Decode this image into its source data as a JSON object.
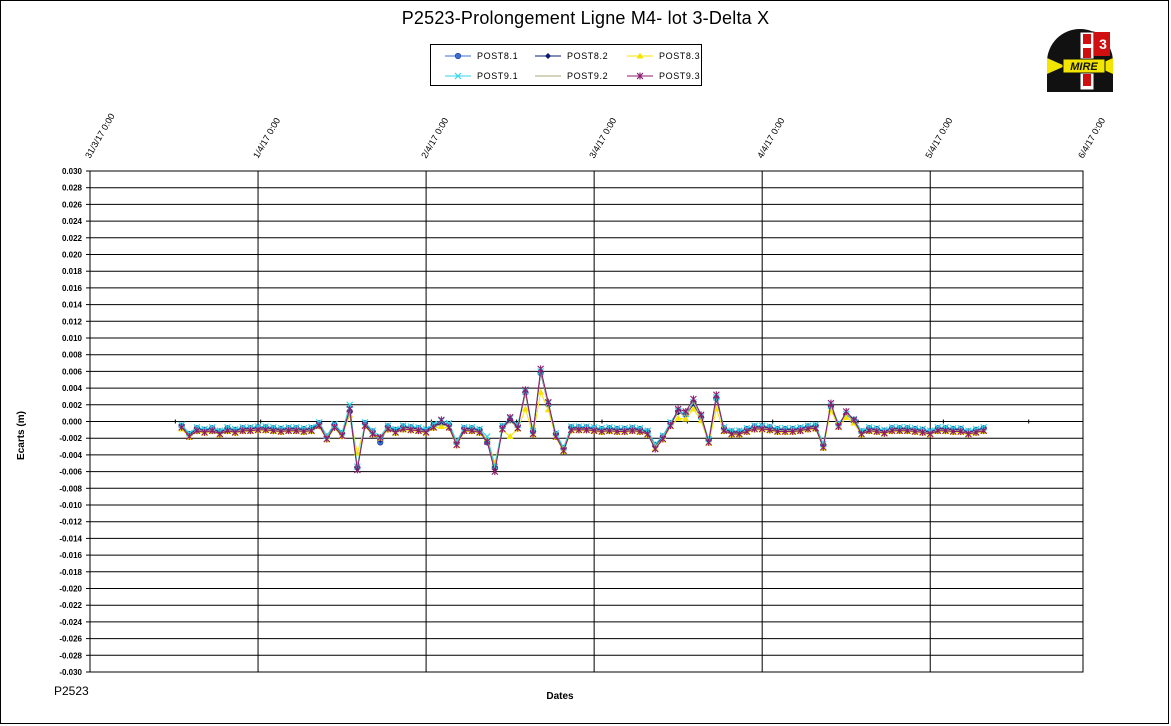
{
  "chart_data": {
    "type": "line",
    "title": "P2523-Prolongement  Ligne  M4- lot 3-Delta X",
    "footer": "P2523",
    "xlabel": "Dates",
    "ylabel": "Ecarts (m)",
    "ylim": [
      -0.03,
      0.03
    ],
    "ytick_step": 0.002,
    "yticks": [
      "0.030",
      "0.028",
      "0.026",
      "0.024",
      "0.022",
      "0.020",
      "0.018",
      "0.016",
      "0.014",
      "0.012",
      "0.010",
      "0.008",
      "0.006",
      "0.004",
      "0.002",
      "0.000",
      "-0.002",
      "-0.004",
      "-0.006",
      "-0.008",
      "-0.010",
      "-0.012",
      "-0.014",
      "-0.016",
      "-0.018",
      "-0.020",
      "-0.022",
      "-0.024",
      "-0.026",
      "-0.028",
      "-0.030"
    ],
    "xlim": [
      "2017-03-31",
      "2017-06-04"
    ],
    "xticks": [
      {
        "label": "31/3/17 0:00",
        "date": "2017-03-31"
      },
      {
        "label": "1/4/17 0:00",
        "date": "2017-04-11"
      },
      {
        "label": "2/4/17 0:00",
        "date": "2017-04-22"
      },
      {
        "label": "3/4/17 0:00",
        "date": "2017-05-03"
      },
      {
        "label": "4/4/17 0:00",
        "date": "2017-05-14"
      },
      {
        "label": "5/4/17 0:00",
        "date": "2017-05-25"
      },
      {
        "label": "6/4/17 0:00",
        "date": "2017-06-04"
      }
    ],
    "grid": true,
    "legend_position": "top-center",
    "x": [
      "2017-04-06",
      "2017-04-06T12",
      "2017-04-07",
      "2017-04-07T12",
      "2017-04-08",
      "2017-04-08T12",
      "2017-04-09",
      "2017-04-09T12",
      "2017-04-10",
      "2017-04-10T12",
      "2017-04-11",
      "2017-04-11T12",
      "2017-04-12",
      "2017-04-12T12",
      "2017-04-13",
      "2017-04-13T12",
      "2017-04-14",
      "2017-04-14T12",
      "2017-04-15",
      "2017-04-15T12",
      "2017-04-16",
      "2017-04-16T12",
      "2017-04-17",
      "2017-04-17T12",
      "2017-04-18",
      "2017-04-18T12",
      "2017-04-19",
      "2017-04-19T12",
      "2017-04-20",
      "2017-04-20T12",
      "2017-04-21",
      "2017-04-21T12",
      "2017-04-22",
      "2017-04-22T12",
      "2017-04-23",
      "2017-04-23T12",
      "2017-04-24",
      "2017-04-24T12",
      "2017-04-25",
      "2017-04-25T12",
      "2017-04-26",
      "2017-04-26T12",
      "2017-04-27",
      "2017-04-27T12",
      "2017-04-28",
      "2017-04-28T12",
      "2017-04-29",
      "2017-04-29T12",
      "2017-04-30",
      "2017-04-30T12",
      "2017-05-01",
      "2017-05-01T12",
      "2017-05-02",
      "2017-05-02T12",
      "2017-05-03",
      "2017-05-03T12",
      "2017-05-04",
      "2017-05-04T12",
      "2017-05-05",
      "2017-05-05T12",
      "2017-05-06",
      "2017-05-06T12",
      "2017-05-07",
      "2017-05-07T12",
      "2017-05-08",
      "2017-05-08T12",
      "2017-05-09",
      "2017-05-09T12",
      "2017-05-10",
      "2017-05-10T12",
      "2017-05-11",
      "2017-05-11T12",
      "2017-05-12",
      "2017-05-12T12",
      "2017-05-13",
      "2017-05-13T12",
      "2017-05-14",
      "2017-05-14T12",
      "2017-05-15",
      "2017-05-15T12",
      "2017-05-16",
      "2017-05-16T12",
      "2017-05-17",
      "2017-05-17T12",
      "2017-05-18",
      "2017-05-18T12",
      "2017-05-19",
      "2017-05-19T12",
      "2017-05-20",
      "2017-05-20T12",
      "2017-05-21",
      "2017-05-21T12",
      "2017-05-22",
      "2017-05-22T12",
      "2017-05-23",
      "2017-05-23T12",
      "2017-05-24",
      "2017-05-24T12",
      "2017-05-25",
      "2017-05-25T12",
      "2017-05-26",
      "2017-05-26T12",
      "2017-05-27",
      "2017-05-27T12",
      "2017-05-28",
      "2017-05-28T12",
      "2017-05-29",
      "2017-05-29T12",
      "2017-05-30",
      "2017-05-30T12"
    ],
    "series": [
      {
        "name": "POST8.1",
        "color": "#3a6fd8",
        "marker": "circle",
        "values": [
          -0.0005,
          -0.0015,
          -0.0008,
          -0.001,
          -0.0008,
          -0.0012,
          -0.0008,
          -0.001,
          -0.0008,
          -0.0008,
          -0.0007,
          -0.0007,
          -0.0008,
          -0.0009,
          -0.0008,
          -0.0008,
          -0.0009,
          -0.0008,
          -0.0002,
          -0.0018,
          -0.0004,
          -0.0014,
          0.0012,
          -0.0055,
          -0.0002,
          -0.0012,
          -0.0025,
          -0.0006,
          -0.001,
          -0.0006,
          -0.0007,
          -0.0008,
          -0.001,
          -0.0004,
          -0.0002,
          -0.0004,
          -0.0025,
          -0.0008,
          -0.0008,
          -0.001,
          -0.0025,
          -0.0055,
          -0.0006,
          0.0002,
          -0.0005,
          0.0035,
          -0.0012,
          0.0058,
          0.002,
          -0.0015,
          -0.0032,
          -0.0007,
          -0.0007,
          -0.0007,
          -0.0008,
          -0.0009,
          -0.0008,
          -0.0009,
          -0.0009,
          -0.0008,
          -0.0009,
          -0.0012,
          -0.0028,
          -0.0018,
          -0.0002,
          0.0012,
          0.0008,
          0.0022,
          0.0005,
          -0.0022,
          0.0028,
          -0.0008,
          -0.0012,
          -0.0012,
          -0.0009,
          -0.0006,
          -0.0006,
          -0.0007,
          -0.0009,
          -0.0009,
          -0.0009,
          -0.0008,
          -0.0006,
          -0.0005,
          -0.0028,
          0.0018,
          -0.0003,
          0.0008,
          0.0002,
          -0.0012,
          -0.0008,
          -0.0009,
          -0.0011,
          -0.0008,
          -0.0008,
          -0.0008,
          -0.0009,
          -0.001,
          -0.0012,
          -0.0008,
          -0.0008,
          -0.0009,
          -0.0009,
          -0.0012,
          -0.001,
          -0.0008
        ]
      },
      {
        "name": "POST8.2",
        "color": "#0d1b6e",
        "marker": "diamond",
        "values": [
          -0.0006,
          -0.0016,
          -0.0009,
          -0.0011,
          -0.0009,
          -0.0013,
          -0.0009,
          -0.0011,
          -0.0009,
          -0.0009,
          -0.0008,
          -0.0008,
          -0.0009,
          -0.001,
          -0.0009,
          -0.0009,
          -0.001,
          -0.0009,
          -0.0003,
          -0.0019,
          -0.0005,
          -0.0015,
          0.0011,
          -0.0056,
          -0.0003,
          -0.0013,
          -0.0022,
          -0.0007,
          -0.0011,
          -0.0007,
          -0.0008,
          -0.0009,
          -0.0011,
          -0.0005,
          -0.0003,
          -0.0005,
          -0.0026,
          -0.0009,
          -0.0009,
          -0.0011,
          -0.0022,
          -0.0056,
          -0.0007,
          0.0001,
          -0.0006,
          0.0034,
          -0.0013,
          0.0059,
          0.0021,
          -0.0016,
          -0.0033,
          -0.0008,
          -0.0008,
          -0.0008,
          -0.0009,
          -0.001,
          -0.0009,
          -0.001,
          -0.001,
          -0.0009,
          -0.001,
          -0.0013,
          -0.0029,
          -0.0019,
          -0.0003,
          0.0011,
          0.0007,
          0.0021,
          0.0004,
          -0.0023,
          0.0027,
          -0.0009,
          -0.0013,
          -0.0013,
          -0.001,
          -0.0007,
          -0.0007,
          -0.0008,
          -0.001,
          -0.001,
          -0.001,
          -0.0009,
          -0.0007,
          -0.0006,
          -0.0029,
          0.0017,
          -0.0004,
          0.0009,
          0.0001,
          -0.0013,
          -0.0009,
          -0.001,
          -0.0012,
          -0.0009,
          -0.0009,
          -0.0009,
          -0.001,
          -0.0011,
          -0.0013,
          -0.0009,
          -0.0009,
          -0.001,
          -0.001,
          -0.0013,
          -0.0011,
          -0.0009
        ]
      },
      {
        "name": "POST8.3",
        "color": "#f5e400",
        "marker": "triangle",
        "values": [
          -0.0009,
          -0.0019,
          -0.0012,
          -0.0014,
          -0.0012,
          -0.0016,
          -0.0012,
          -0.0014,
          -0.0012,
          -0.0012,
          -0.0011,
          -0.0011,
          -0.0012,
          -0.0013,
          -0.0012,
          -0.0012,
          -0.0013,
          -0.0012,
          -0.0006,
          -0.0022,
          -0.0008,
          -0.0018,
          0.0008,
          -0.0038,
          -0.0006,
          -0.0016,
          -0.002,
          -0.001,
          -0.0014,
          -0.001,
          -0.0011,
          -0.0012,
          -0.0014,
          -0.0008,
          -0.0006,
          -0.0008,
          -0.0029,
          -0.0012,
          -0.0012,
          -0.0014,
          -0.002,
          -0.005,
          -0.001,
          -0.0018,
          -0.0009,
          0.0015,
          -0.0016,
          0.0035,
          0.0014,
          -0.0019,
          -0.0036,
          -0.0011,
          -0.0011,
          -0.0011,
          -0.0012,
          -0.0013,
          -0.0012,
          -0.0013,
          -0.0013,
          -0.0012,
          -0.0013,
          -0.0016,
          -0.0032,
          -0.0022,
          -0.0006,
          0.0004,
          0.0003,
          0.0015,
          0.0001,
          -0.0026,
          0.0015,
          -0.0012,
          -0.0016,
          -0.0016,
          -0.0013,
          -0.001,
          -0.001,
          -0.0011,
          -0.0013,
          -0.0013,
          -0.0013,
          -0.0012,
          -0.001,
          -0.0009,
          -0.0032,
          0.0014,
          -0.0007,
          0.0005,
          -0.0002,
          -0.0016,
          -0.0012,
          -0.0013,
          -0.0015,
          -0.0012,
          -0.0012,
          -0.0012,
          -0.0013,
          -0.0014,
          -0.0016,
          -0.0012,
          -0.0012,
          -0.0013,
          -0.0013,
          -0.0016,
          -0.0014,
          -0.0012
        ]
      },
      {
        "name": "POST9.1",
        "color": "#33d6e6",
        "marker": "x",
        "values": [
          -0.0004,
          -0.0014,
          -0.0007,
          -0.0009,
          -0.0007,
          -0.0011,
          -0.0007,
          -0.0009,
          -0.0007,
          -0.0007,
          -0.0006,
          -0.0006,
          -0.0007,
          -0.0008,
          -0.0007,
          -0.0007,
          -0.0008,
          -0.0007,
          -0.0001,
          -0.0017,
          -0.0003,
          -0.0013,
          0.002,
          -0.0054,
          -0.0001,
          -0.0011,
          -0.0018,
          -0.0005,
          -0.0009,
          -0.0005,
          -0.0006,
          -0.0007,
          -0.0009,
          -0.0003,
          0.0001,
          -0.0002,
          -0.0024,
          -0.0007,
          -0.0007,
          -0.0009,
          -0.0018,
          -0.0054,
          -0.0005,
          0.0004,
          -0.0004,
          0.0036,
          -0.0011,
          0.006,
          0.0022,
          -0.0014,
          -0.0031,
          -0.0006,
          -0.0006,
          -0.0006,
          -0.0007,
          -0.0008,
          -0.0007,
          -0.0008,
          -0.0008,
          -0.0007,
          -0.0008,
          -0.0011,
          -0.0027,
          -0.0017,
          -0.0001,
          0.0013,
          0.0009,
          0.0023,
          0.0006,
          -0.0021,
          0.0029,
          -0.0007,
          -0.0011,
          -0.0011,
          -0.0008,
          -0.0005,
          -0.0005,
          -0.0006,
          -0.0008,
          -0.0008,
          -0.0008,
          -0.0007,
          -0.0005,
          -0.0004,
          -0.0027,
          0.0019,
          -0.0002,
          0.0009,
          0.0003,
          -0.0011,
          -0.0007,
          -0.0008,
          -0.001,
          -0.0007,
          -0.0007,
          -0.0007,
          -0.0008,
          -0.0009,
          -0.0011,
          -0.0007,
          -0.0007,
          -0.0008,
          -0.0008,
          -0.0011,
          -0.0009,
          -0.0007
        ]
      },
      {
        "name": "POST9.2",
        "color": "#a8a878",
        "marker": "none",
        "values": [
          -0.0006,
          -0.0017,
          -0.001,
          -0.0012,
          -0.001,
          -0.0014,
          -0.001,
          -0.0012,
          -0.001,
          -0.001,
          -0.0009,
          -0.0009,
          -0.001,
          -0.0011,
          -0.001,
          -0.001,
          -0.0011,
          -0.001,
          -0.0004,
          -0.002,
          -0.0006,
          -0.0016,
          0.001,
          -0.0056,
          -0.0004,
          -0.0014,
          -0.0019,
          -0.0008,
          -0.0012,
          -0.0008,
          -0.0009,
          -0.001,
          -0.0012,
          -0.0006,
          -0.0004,
          -0.0006,
          -0.0027,
          -0.001,
          -0.001,
          -0.0012,
          -0.0023,
          -0.0058,
          -0.0008,
          0,
          -0.0007,
          0.0034,
          -0.0014,
          0.006,
          0.0019,
          -0.0017,
          -0.0034,
          -0.0009,
          -0.0009,
          -0.0009,
          -0.001,
          -0.0011,
          -0.001,
          -0.0011,
          -0.0011,
          -0.001,
          -0.0011,
          -0.0014,
          -0.003,
          -0.002,
          -0.0004,
          0.0012,
          0.0006,
          0.0024,
          0.0003,
          -0.0024,
          0.003,
          -0.001,
          -0.0014,
          -0.0014,
          -0.0011,
          -0.0008,
          -0.0008,
          -0.0009,
          -0.0011,
          -0.0011,
          -0.0011,
          -0.001,
          -0.0008,
          -0.0007,
          -0.003,
          0.002,
          -0.0005,
          0.001,
          0,
          -0.0014,
          -0.001,
          -0.0011,
          -0.0013,
          -0.001,
          -0.001,
          -0.001,
          -0.0011,
          -0.0012,
          -0.0014,
          -0.001,
          -0.001,
          -0.0011,
          -0.0011,
          -0.0014,
          -0.0012,
          -0.001
        ]
      },
      {
        "name": "POST9.3",
        "color": "#8a1a6e",
        "marker": "star",
        "values": [
          -0.0007,
          -0.0018,
          -0.0011,
          -0.0013,
          -0.0011,
          -0.0015,
          -0.0011,
          -0.0013,
          -0.0011,
          -0.0011,
          -0.001,
          -0.001,
          -0.0011,
          -0.0012,
          -0.0011,
          -0.0011,
          -0.0012,
          -0.0011,
          -0.0005,
          -0.0021,
          -0.0007,
          -0.0017,
          0.0015,
          -0.0058,
          -0.0005,
          -0.0015,
          -0.0019,
          -0.0009,
          -0.0013,
          -0.0009,
          -0.001,
          -0.0011,
          -0.0013,
          -0.0007,
          0.0002,
          -0.0007,
          -0.0028,
          -0.0011,
          -0.0011,
          -0.0013,
          -0.0024,
          -0.006,
          -0.0009,
          0.0005,
          -0.0008,
          0.0038,
          -0.0015,
          0.0063,
          0.0023,
          -0.0018,
          -0.0035,
          -0.001,
          -0.001,
          -0.001,
          -0.0011,
          -0.0012,
          -0.0011,
          -0.0012,
          -0.0012,
          -0.0011,
          -0.0012,
          -0.0015,
          -0.0033,
          -0.0021,
          -0.0005,
          0.0015,
          0.0012,
          0.0027,
          0.0008,
          -0.0025,
          0.0032,
          -0.0011,
          -0.0015,
          -0.0015,
          -0.0012,
          -0.0009,
          -0.0009,
          -0.001,
          -0.0012,
          -0.0012,
          -0.0012,
          -0.0011,
          -0.0009,
          -0.0008,
          -0.0031,
          0.0022,
          -0.0006,
          0.0012,
          0.0002,
          -0.0015,
          -0.0011,
          -0.0012,
          -0.0014,
          -0.0011,
          -0.0011,
          -0.0011,
          -0.0012,
          -0.0013,
          -0.0015,
          -0.0011,
          -0.0011,
          -0.0012,
          -0.0012,
          -0.0015,
          -0.0013,
          -0.0011
        ]
      }
    ]
  },
  "logo": {
    "text": "MIRE",
    "icon": "mire-logo-icon",
    "colors": {
      "dark": "#111111",
      "red": "#d01010",
      "yellow": "#f2e600",
      "white": "#ffffff"
    }
  }
}
